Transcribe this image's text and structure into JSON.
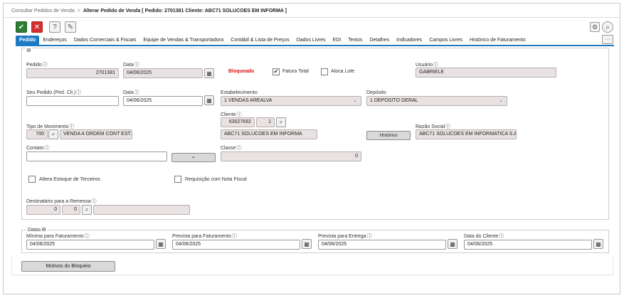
{
  "breadcrumb": {
    "parent": "Consultar Pedidos de Venda",
    "separator": ">",
    "current": "Alterar Pedido de Venda [ Pedido: 2701381 Cliente: ABC71 SOLUCOES EM INFORMA ]"
  },
  "toolbar": {
    "confirm": "✔",
    "cancel": "✕",
    "help": "?",
    "tools": "✎",
    "settings": "⚙",
    "search": "⌕",
    "more": "···"
  },
  "tabs": [
    "Pedido",
    "Endereços",
    "Dados Comerciais & Fiscais",
    "Equipe de Vendas & Transportadora",
    "Contábil & Lista de Preços",
    "Dados Livres",
    "EDI",
    "Textos",
    "Detalhes",
    "Indicadores",
    "Campos Livres",
    "Histórico de Faturamento"
  ],
  "colors": {
    "accent": "#1f7ac4",
    "confirm": "#2e7d32",
    "cancel": "#d32f2f",
    "blocked": "#e01010"
  },
  "form": {
    "collapse": "⊖",
    "pedido": {
      "label": "Pedido",
      "value": "2701381"
    },
    "data1": {
      "label": "Data",
      "value": "04/06/2025"
    },
    "bloqueado": "Bloqueado",
    "fatura_total": {
      "label": "Fatura Total",
      "checked": true
    },
    "aloca_lote": {
      "label": "Aloca Lote",
      "checked": false
    },
    "usuario": {
      "label": "Usuário",
      "value": "GABRIELE"
    },
    "seu_pedido": {
      "label": "Seu Pedido (Ped. Cli.)",
      "value": ""
    },
    "data2": {
      "label": "Data",
      "value": "04/06/2025"
    },
    "estabelecimento": {
      "label": "Estabelecimento",
      "value": "1 VENDAS AREALVA"
    },
    "deposito": {
      "label": "Depósito",
      "value": "1 DEPOSITO GERAL"
    },
    "cliente": {
      "label": "Cliente",
      "code": "63027692",
      "seq": "1",
      "name": "ABC71 SOLUCOES EM INFORMA"
    },
    "tipo_movimento": {
      "label": "Tipo de Movimento",
      "code": "700",
      "desc": "VENDA A ORDEM CONT EST.3."
    },
    "historico_button": "Histórico",
    "razao_social": {
      "label": "Razão Social",
      "value": "ABC71 SOLUCOES EM INFORMATICA S.A."
    },
    "contato": {
      "label": "Contato",
      "value": ""
    },
    "classe": {
      "label": "Classe",
      "value": "0"
    },
    "altera_estoque": {
      "label": "Altera Estoque de Terceiros",
      "checked": false
    },
    "requisicao_nf": {
      "label": "Requisição com Nota Fiscal",
      "checked": false
    },
    "destinatario": {
      "label": "Destinatário para a Remessa",
      "code1": "0",
      "code2": "0",
      "desc": ""
    }
  },
  "datas": {
    "title": "Datas",
    "minima": {
      "label": "Mínima para Faturamento",
      "value": "04/06/2025"
    },
    "prev_fat": {
      "label": "Prevista para Faturamento",
      "value": "04/06/2025"
    },
    "prev_ent": {
      "label": "Prevista para Entrega",
      "value": "04/06/2025"
    },
    "cliente": {
      "label": "Data do Cliente",
      "value": "04/06/2025"
    }
  },
  "motivos_button": "Motivos do Bloqueio",
  "icons": {
    "info": "ⓘ",
    "calendar": "▦",
    "search": "⌕",
    "chevron": "⌄",
    "checkmark": "✔"
  }
}
